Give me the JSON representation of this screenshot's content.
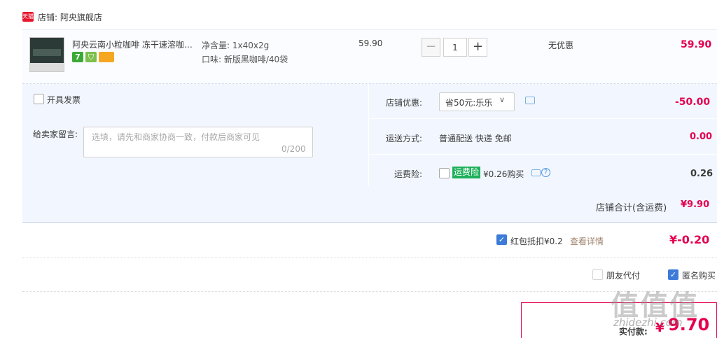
{
  "shop": {
    "badge": "天猫",
    "label": "店铺: 阿央旗舰店"
  },
  "item": {
    "title": "阿央云南小粒咖啡 冻干速溶咖啡…",
    "icons": [
      "seven-day-return-icon",
      "guarantee-shield-icon",
      "credit-card-icon"
    ],
    "icon_glyphs": {
      "seven": "7",
      "shield": "⛉"
    },
    "sku_spec": "净含量: 1x40x2g",
    "sku_flavor": "口味: 新版黑咖啡/40袋",
    "unit_price": "59.90",
    "quantity": "1",
    "minus": "−",
    "plus": "+",
    "promotion": "无优惠",
    "total": "59.90"
  },
  "options": {
    "invoice_label": "开具发票",
    "message_label": "给卖家留言:",
    "message_placeholder": "选填，请先和商家协商一致，付款后商家可见",
    "message_count": "0/200",
    "shop_discount_label": "店铺优惠:",
    "shop_discount_selected": "省50元:乐乐",
    "shop_discount_value": "-50.00",
    "shipping_label": "运送方式:",
    "shipping_text": "普通配送 快递 免邮",
    "shipping_value": "0.00",
    "insurance_label": "运费险:",
    "insurance_tag": "运费险",
    "insurance_price": "¥0.26购买",
    "insurance_help": "?",
    "insurance_value": "0.26"
  },
  "subtotal": {
    "label": "店铺合计(含运费)",
    "value": "¥9.90"
  },
  "red_packet": {
    "checked": true,
    "label": "红包抵扣¥0.2",
    "detail": "查看详情",
    "value": "¥-0.20"
  },
  "pay_options": {
    "friend_label": "朋友代付",
    "friend_checked": false,
    "anonymous_label": "匿名购买",
    "anonymous_checked": true,
    "check_mark": "✓"
  },
  "payment": {
    "label": "实付款:",
    "currency": "¥",
    "value": "9.70"
  },
  "watermark": {
    "logo": "值值值",
    "site": "zhidezhi.com"
  },
  "colors": {
    "price_red": "#e5004f",
    "accent_blue": "#3d7bd9",
    "panel_bg": "#f2f7ff",
    "tag_green": "#1eb05a"
  }
}
